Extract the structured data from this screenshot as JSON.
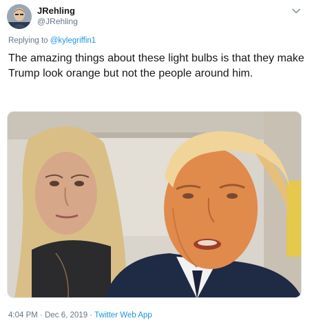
{
  "author": {
    "display_name": "JRehling",
    "handle": "@JRehling",
    "avatar_icon": "user-avatar-icon"
  },
  "reply": {
    "prefix": "Replying to",
    "mention": "@kylegriffin1"
  },
  "tweet": {
    "text": "The amazing things about these light bulbs is that they make Trump look orange but not the people around him."
  },
  "meta": {
    "time": "4:04 PM",
    "separator1": "·",
    "date": "Dec 6, 2019",
    "separator2": "·",
    "source": "Twitter Web App"
  },
  "colors": {
    "link": "#1b95e0",
    "secondary_text": "#657786",
    "primary_text": "#14171a"
  },
  "icons": {
    "menu": "chevron-down-icon"
  }
}
